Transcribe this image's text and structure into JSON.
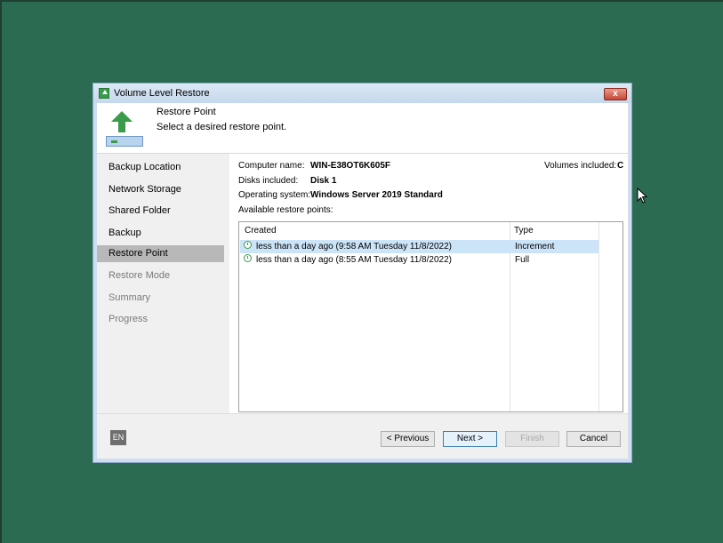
{
  "window": {
    "title": "Volume Level Restore",
    "close_label": "x"
  },
  "header": {
    "step_title": "Restore Point",
    "step_desc": "Select a desired restore point."
  },
  "sidebar": {
    "items": [
      {
        "label": "Backup Location",
        "state": "done"
      },
      {
        "label": "Network Storage",
        "state": "done"
      },
      {
        "label": "Shared Folder",
        "state": "done"
      },
      {
        "label": "Backup",
        "state": "done"
      },
      {
        "label": "Restore Point",
        "state": "active"
      },
      {
        "label": "Restore Mode",
        "state": "inactive"
      },
      {
        "label": "Summary",
        "state": "inactive"
      },
      {
        "label": "Progress",
        "state": "inactive"
      }
    ]
  },
  "info": {
    "computer_label": "Computer name:",
    "computer_value": "WIN-E38OT6K605F",
    "disks_label": "Disks included:",
    "disks_value": "Disk 1",
    "os_label": "Operating system:",
    "os_value": "Windows Server 2019 Standard",
    "volumes_label": "Volumes included:",
    "volumes_value": "C",
    "available_label": "Available restore points:"
  },
  "table": {
    "headers": {
      "created": "Created",
      "type": "Type"
    },
    "rows": [
      {
        "created": "less than a day ago (9:58 AM Tuesday 11/8/2022)",
        "type": "Increment",
        "selected": true
      },
      {
        "created": "less than a day ago (8:55 AM Tuesday 11/8/2022)",
        "type": "Full",
        "selected": false
      }
    ]
  },
  "footer": {
    "language": "EN",
    "previous": "< Previous",
    "next": "Next >",
    "finish": "Finish",
    "cancel": "Cancel"
  },
  "colors": {
    "desktop": "#2a6b52",
    "accent_green": "#3a9b4a",
    "selection": "#cce4f7"
  }
}
